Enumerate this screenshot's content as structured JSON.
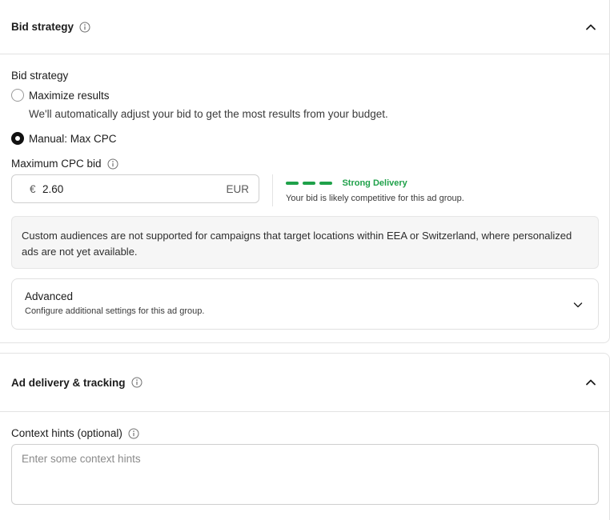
{
  "bid_section": {
    "title": "Bid strategy",
    "field_label": "Bid strategy",
    "options": [
      {
        "label": "Maximize results",
        "helper": "We'll automatically adjust your bid to get the most results from your budget.",
        "selected": false
      },
      {
        "label": "Manual: Max CPC",
        "selected": true
      }
    ],
    "max_cpc": {
      "label": "Maximum CPC bid",
      "currency_symbol": "€",
      "value": "2.60",
      "currency_code": "EUR"
    },
    "delivery": {
      "title": "Strong Delivery",
      "subtitle": "Your bid is likely competitive for this ad group.",
      "level": "3/3",
      "color": "#1fa14a"
    },
    "notice": "Custom audiences are not supported for campaigns that target locations within EEA or Switzerland, where personalized ads are not yet available.",
    "advanced": {
      "title": "Advanced",
      "subtitle": "Configure additional settings for this ad group."
    }
  },
  "tracking_section": {
    "title": "Ad delivery & tracking",
    "context_label": "Context hints (optional)",
    "context_placeholder": "Enter some context hints"
  }
}
